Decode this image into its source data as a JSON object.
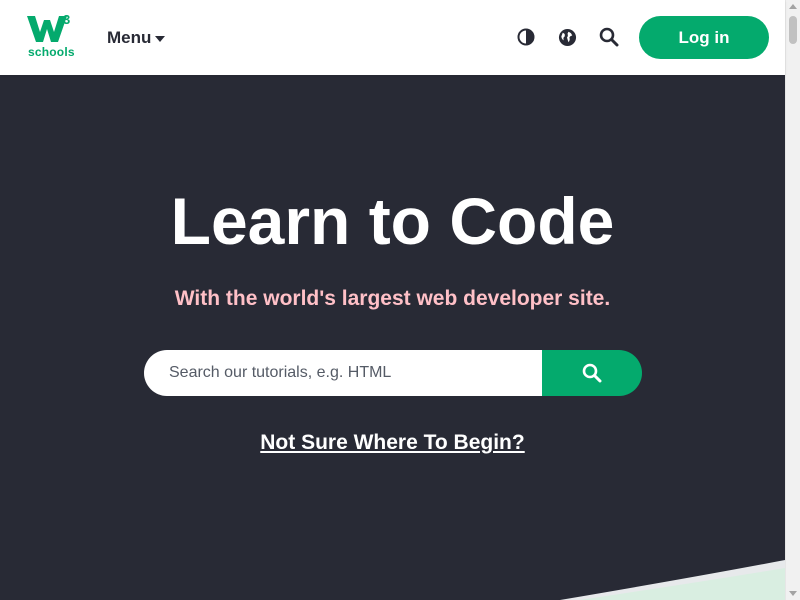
{
  "colors": {
    "brand_green": "#04AA6D",
    "hero_background": "#282A35",
    "subtitle_pink": "#FFC0C7",
    "text_dark": "#282A35"
  },
  "navbar": {
    "logo": {
      "sup": "3",
      "word": "schools",
      "icon": "w3schools-logo"
    },
    "menu_label": "Menu",
    "menu_icon": "caret-down-icon",
    "icons": [
      "contrast-icon",
      "globe-icon",
      "search-icon"
    ],
    "login_label": "Log in"
  },
  "hero": {
    "title": "Learn to Code",
    "subtitle": "With the world's largest web developer site.",
    "search": {
      "placeholder": "Search our tutorials, e.g. HTML",
      "value": "",
      "button_icon": "search-icon"
    },
    "begin_link": "Not Sure Where To Begin?"
  }
}
